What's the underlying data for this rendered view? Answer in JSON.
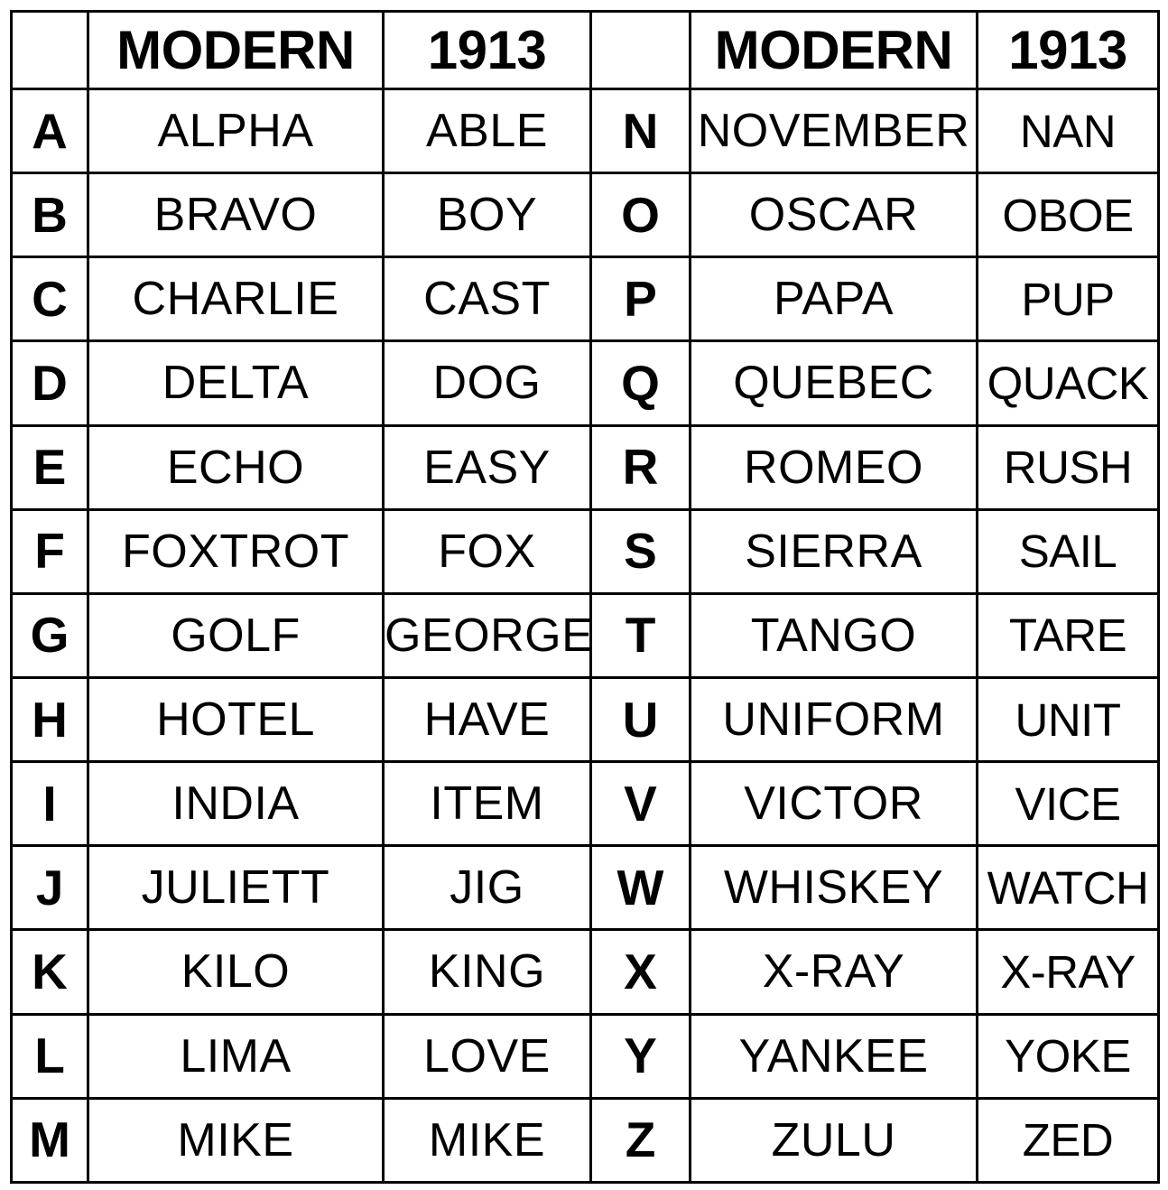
{
  "document": {
    "type": "reference-table",
    "title": "NATO Phonetic Alphabet Comparison",
    "colors": {
      "border": "#000000",
      "background": "#ffffff",
      "text": "#000000"
    }
  },
  "headers": {
    "letter_blank_left": "",
    "modern_left": "MODERN",
    "year_left": "1913",
    "letter_blank_right": "",
    "modern_right": "MODERN",
    "year_right": "1913"
  },
  "left_table": {
    "rows": [
      {
        "letter": "A",
        "modern": "ALPHA",
        "y1913": "ABLE"
      },
      {
        "letter": "B",
        "modern": "BRAVO",
        "y1913": "BOY"
      },
      {
        "letter": "C",
        "modern": "CHARLIE",
        "y1913": "CAST"
      },
      {
        "letter": "D",
        "modern": "DELTA",
        "y1913": "DOG"
      },
      {
        "letter": "E",
        "modern": "ECHO",
        "y1913": "EASY"
      },
      {
        "letter": "F",
        "modern": "FOXTROT",
        "y1913": "FOX"
      },
      {
        "letter": "G",
        "modern": "GOLF",
        "y1913": "GEORGE"
      },
      {
        "letter": "H",
        "modern": "HOTEL",
        "y1913": "HAVE"
      },
      {
        "letter": "I",
        "modern": "INDIA",
        "y1913": "ITEM"
      },
      {
        "letter": "J",
        "modern": "JULIETT",
        "y1913": "JIG"
      },
      {
        "letter": "K",
        "modern": "KILO",
        "y1913": "KING"
      },
      {
        "letter": "L",
        "modern": "LIMA",
        "y1913": "LOVE"
      },
      {
        "letter": "M",
        "modern": "MIKE",
        "y1913": "MIKE"
      }
    ]
  },
  "right_table": {
    "rows": [
      {
        "letter": "N",
        "modern": "NOVEMBER",
        "y1913": "NAN"
      },
      {
        "letter": "O",
        "modern": "OSCAR",
        "y1913": "OBOE"
      },
      {
        "letter": "P",
        "modern": "PAPA",
        "y1913": "PUP"
      },
      {
        "letter": "Q",
        "modern": "QUEBEC",
        "y1913": "QUACK"
      },
      {
        "letter": "R",
        "modern": "ROMEO",
        "y1913": "RUSH"
      },
      {
        "letter": "S",
        "modern": "SIERRA",
        "y1913": "SAIL"
      },
      {
        "letter": "T",
        "modern": "TANGO",
        "y1913": "TARE"
      },
      {
        "letter": "U",
        "modern": "UNIFORM",
        "y1913": "UNIT"
      },
      {
        "letter": "V",
        "modern": "VICTOR",
        "y1913": "VICE"
      },
      {
        "letter": "W",
        "modern": "WHISKEY",
        "y1913": "WATCH"
      },
      {
        "letter": "X",
        "modern": "X-RAY",
        "y1913": "X-RAY"
      },
      {
        "letter": "Y",
        "modern": "YANKEE",
        "y1913": "YOKE"
      },
      {
        "letter": "Z",
        "modern": "ZULU",
        "y1913": "ZED"
      }
    ]
  }
}
